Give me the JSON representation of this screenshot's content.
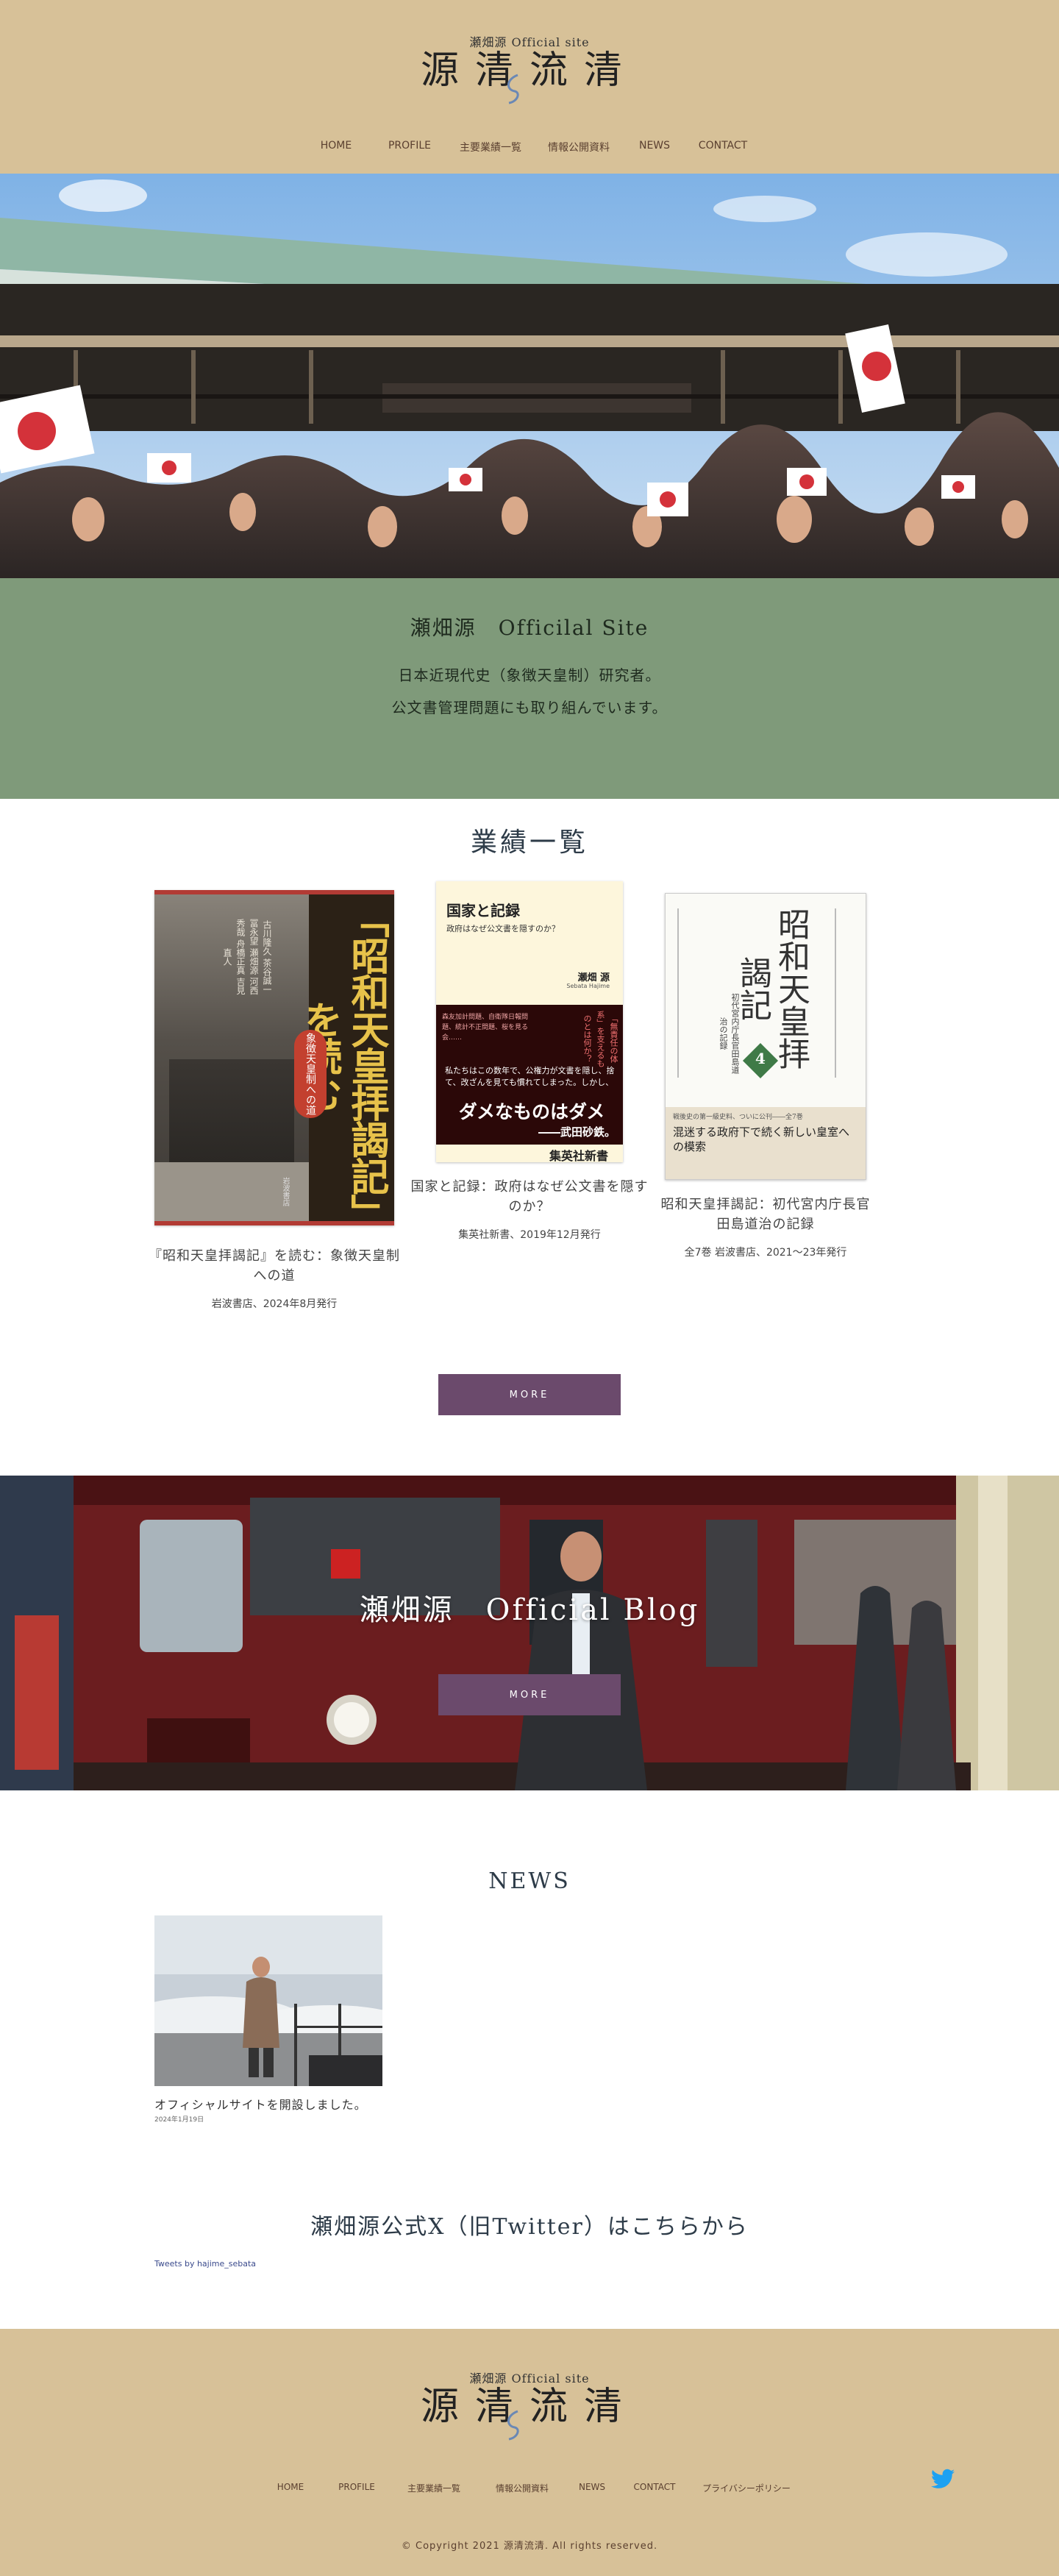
{
  "header": {
    "logo_sub": "瀬畑源 Official site",
    "logo_main": "源清流清",
    "nav": [
      "HOME",
      "PROFILE",
      "主要業績一覧",
      "情報公開資料",
      "NEWS",
      "CONTACT"
    ]
  },
  "intro": {
    "title": "瀬畑源　Officilal Site",
    "line1": "日本近現代史（象徴天皇制）研究者。",
    "line2": "公文書管理問題にも取り組んでいます。"
  },
  "works": {
    "title": "業績一覧",
    "books": [
      {
        "title": "『昭和天皇拝謁記』を読む：象徴天皇制への道",
        "meta": "岩波書店、2024年8月発行",
        "cover_big": "「昭和天皇拝謁記」を読む",
        "cover_badge": "象徴天皇制への道",
        "cover_authors": [
          "古川隆久",
          "茶谷誠一",
          "冨永望",
          "瀬畑源",
          "河西秀哉",
          "舟橋正真",
          "吉見直人"
        ],
        "cover_publisher": "岩波書店"
      },
      {
        "title": "国家と記録：政府はなぜ公文書を隠すのか？",
        "meta": "集英社新書、2019年12月発行",
        "cover_title": "国家と記録",
        "cover_subtitle": "政府はなぜ公文書を隠すのか？",
        "cover_author": "瀬畑 源",
        "cover_author_roman": "Sebata Hajime",
        "cover_band_left": "森友加計問題、自衛隊日報問題、統計不正問題、桜を見る会……",
        "cover_band_red": "「無責任の体系」を支えるものとは何か？",
        "cover_band_body": "私たちはこの数年で、公権力が文書を隠し、捨て、改ざんを見ても慣れてしまった。しかし、",
        "cover_quote": "ダメなものはダメ",
        "cover_quote_by": "――武田砂鉄。",
        "cover_publisher": "集英社新書"
      },
      {
        "title": "昭和天皇拝謁記：初代宮内庁長官田島道治の記録",
        "meta": "全7巻 岩波書店、2021～23年発行",
        "cover_title": "昭和天皇拝謁記",
        "cover_subtitle": "初代宮内庁長官田島道治の記録",
        "cover_vol": "4",
        "cover_band_top": "戦後史の第一級史料、ついに公刊――全7巻",
        "cover_band_main": "混迷する政府下で続く新しい皇室への模索"
      }
    ],
    "more": "MORE"
  },
  "blog": {
    "title": "瀬畑源　Official Blog",
    "more": "MORE"
  },
  "news": {
    "title": "NEWS",
    "items": [
      {
        "title": "オフィシャルサイトを開設しました。",
        "date": "2024年1月19日"
      }
    ]
  },
  "x_section": {
    "title": "瀬畑源公式X（旧Twitter）はこちらから",
    "link": "Tweets by hajime_sebata"
  },
  "footer": {
    "nav": [
      "HOME",
      "PROFILE",
      "主要業績一覧",
      "情報公開資料",
      "NEWS",
      "CONTACT",
      "プライバシーポリシー"
    ],
    "copyright": "© Copyright 2021 源清流清. All rights reserved."
  },
  "colors": {
    "header_bg": "#d7c198",
    "intro_bg": "#7f9a7a",
    "button": "#6b4a6c",
    "nav_text": "#5a3f2f",
    "twitter": "#1da1f2"
  }
}
